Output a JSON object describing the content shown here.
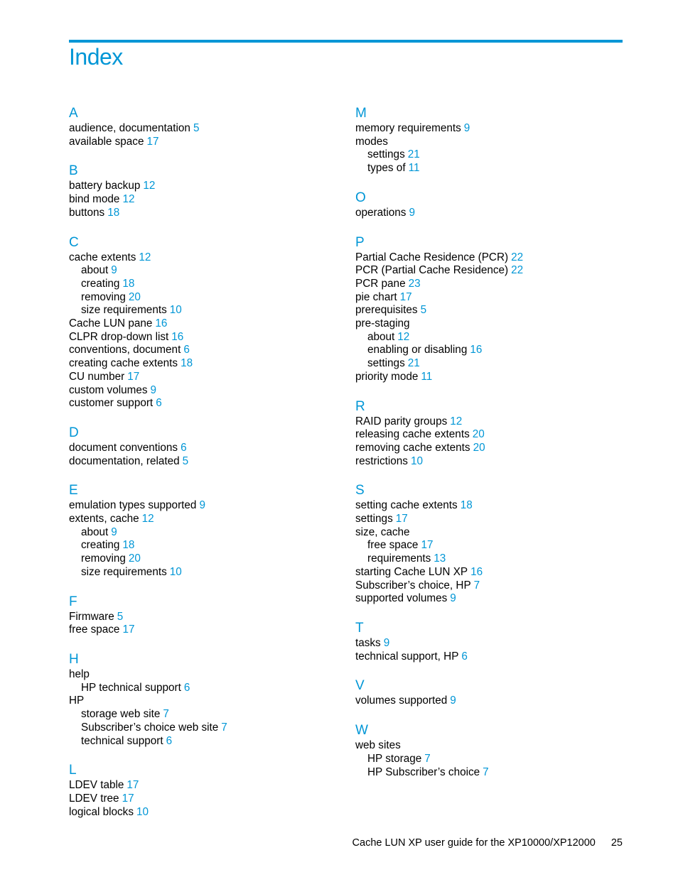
{
  "page": {
    "title": "Index",
    "accent_color": "#0096d6",
    "footer_text": "Cache LUN XP user guide for the XP10000/XP12000",
    "page_number": "25"
  },
  "columns": [
    [
      {
        "letter": "A",
        "entries": [
          {
            "text": "audience, documentation",
            "page": "5",
            "sub": false
          },
          {
            "text": "available space",
            "page": "17",
            "sub": false
          }
        ]
      },
      {
        "letter": "B",
        "entries": [
          {
            "text": "battery backup",
            "page": "12",
            "sub": false
          },
          {
            "text": "bind mode",
            "page": "12",
            "sub": false
          },
          {
            "text": "buttons",
            "page": "18",
            "sub": false
          }
        ]
      },
      {
        "letter": "C",
        "entries": [
          {
            "text": "cache extents",
            "page": "12",
            "sub": false
          },
          {
            "text": "about",
            "page": "9",
            "sub": true
          },
          {
            "text": "creating",
            "page": "18",
            "sub": true
          },
          {
            "text": "removing",
            "page": "20",
            "sub": true
          },
          {
            "text": "size requirements",
            "page": "10",
            "sub": true
          },
          {
            "text": "Cache LUN pane",
            "page": "16",
            "sub": false
          },
          {
            "text": "CLPR drop-down list",
            "page": "16",
            "sub": false
          },
          {
            "text": "conventions, document",
            "page": "6",
            "sub": false
          },
          {
            "text": "creating cache extents",
            "page": "18",
            "sub": false
          },
          {
            "text": "CU number",
            "page": "17",
            "sub": false
          },
          {
            "text": "custom volumes",
            "page": "9",
            "sub": false
          },
          {
            "text": "customer support",
            "page": "6",
            "sub": false
          }
        ]
      },
      {
        "letter": "D",
        "entries": [
          {
            "text": "document conventions",
            "page": "6",
            "sub": false
          },
          {
            "text": "documentation, related",
            "page": "5",
            "sub": false
          }
        ]
      },
      {
        "letter": "E",
        "entries": [
          {
            "text": "emulation types supported",
            "page": "9",
            "sub": false
          },
          {
            "text": "extents, cache",
            "page": "12",
            "sub": false
          },
          {
            "text": "about",
            "page": "9",
            "sub": true
          },
          {
            "text": "creating",
            "page": "18",
            "sub": true
          },
          {
            "text": "removing",
            "page": "20",
            "sub": true
          },
          {
            "text": "size requirements",
            "page": "10",
            "sub": true
          }
        ]
      },
      {
        "letter": "F",
        "entries": [
          {
            "text": "Firmware",
            "page": "5",
            "sub": false
          },
          {
            "text": "free space",
            "page": "17",
            "sub": false
          }
        ]
      },
      {
        "letter": "H",
        "entries": [
          {
            "text": "help",
            "page": "",
            "sub": false
          },
          {
            "text": "HP technical support",
            "page": "6",
            "sub": true
          },
          {
            "text": "HP",
            "page": "",
            "sub": false
          },
          {
            "text": "storage web site",
            "page": "7",
            "sub": true
          },
          {
            "text": "Subscriber’s choice web site",
            "page": "7",
            "sub": true
          },
          {
            "text": "technical support",
            "page": "6",
            "sub": true
          }
        ]
      },
      {
        "letter": "L",
        "entries": [
          {
            "text": "LDEV table",
            "page": "17",
            "sub": false
          },
          {
            "text": "LDEV tree",
            "page": "17",
            "sub": false
          },
          {
            "text": "logical blocks",
            "page": "10",
            "sub": false
          }
        ]
      }
    ],
    [
      {
        "letter": "M",
        "entries": [
          {
            "text": "memory requirements",
            "page": "9",
            "sub": false
          },
          {
            "text": "modes",
            "page": "",
            "sub": false
          },
          {
            "text": "settings",
            "page": "21",
            "sub": true
          },
          {
            "text": "types of",
            "page": "11",
            "sub": true
          }
        ]
      },
      {
        "letter": "O",
        "entries": [
          {
            "text": "operations",
            "page": "9",
            "sub": false
          }
        ]
      },
      {
        "letter": "P",
        "entries": [
          {
            "text": "Partial Cache Residence (PCR)",
            "page": "22",
            "sub": false
          },
          {
            "text": "PCR (Partial Cache Residence)",
            "page": "22",
            "sub": false
          },
          {
            "text": "PCR pane",
            "page": "23",
            "sub": false
          },
          {
            "text": "pie chart",
            "page": "17",
            "sub": false
          },
          {
            "text": "prerequisites",
            "page": "5",
            "sub": false
          },
          {
            "text": "pre-staging",
            "page": "",
            "sub": false
          },
          {
            "text": "about",
            "page": "12",
            "sub": true
          },
          {
            "text": "enabling or disabling",
            "page": "16",
            "sub": true
          },
          {
            "text": "settings",
            "page": "21",
            "sub": true
          },
          {
            "text": "priority mode",
            "page": "11",
            "sub": false
          }
        ]
      },
      {
        "letter": "R",
        "entries": [
          {
            "text": "RAID parity groups",
            "page": "12",
            "sub": false
          },
          {
            "text": "releasing cache extents",
            "page": "20",
            "sub": false
          },
          {
            "text": "removing cache extents",
            "page": "20",
            "sub": false
          },
          {
            "text": "restrictions",
            "page": "10",
            "sub": false
          }
        ]
      },
      {
        "letter": "S",
        "entries": [
          {
            "text": "setting cache extents",
            "page": "18",
            "sub": false
          },
          {
            "text": "settings",
            "page": "17",
            "sub": false
          },
          {
            "text": "size, cache",
            "page": "",
            "sub": false
          },
          {
            "text": "free space",
            "page": "17",
            "sub": true
          },
          {
            "text": "requirements",
            "page": "13",
            "sub": true
          },
          {
            "text": "starting Cache LUN XP",
            "page": "16",
            "sub": false
          },
          {
            "text": "Subscriber’s choice, HP",
            "page": "7",
            "sub": false
          },
          {
            "text": "supported volumes",
            "page": "9",
            "sub": false
          }
        ]
      },
      {
        "letter": "T",
        "entries": [
          {
            "text": "tasks",
            "page": "9",
            "sub": false
          },
          {
            "text": "technical support, HP",
            "page": "6",
            "sub": false
          }
        ]
      },
      {
        "letter": "V",
        "entries": [
          {
            "text": "volumes supported",
            "page": "9",
            "sub": false
          }
        ]
      },
      {
        "letter": "W",
        "entries": [
          {
            "text": "web sites",
            "page": "",
            "sub": false
          },
          {
            "text": "HP storage",
            "page": "7",
            "sub": true
          },
          {
            "text": "HP Subscriber’s choice",
            "page": "7",
            "sub": true
          }
        ]
      }
    ]
  ]
}
